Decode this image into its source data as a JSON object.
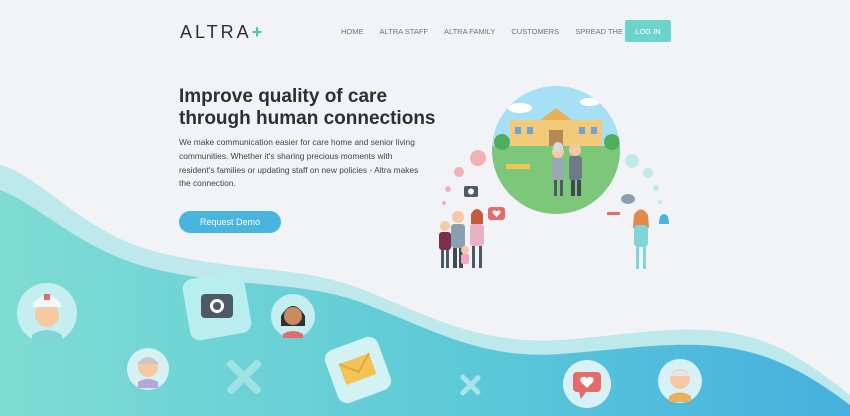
{
  "brand": {
    "name": "ALTRA",
    "mark": "+"
  },
  "nav": {
    "items": [
      "HOME",
      "ALTRA STAFF",
      "ALTRA FAMILY",
      "CUSTOMERS",
      "SPREAD THE WORD"
    ],
    "login_label": "LOG IN"
  },
  "hero": {
    "title_line1": "Improve quality of care",
    "title_line2": "through human connections",
    "body": "We make communication easier for care home and senior living communities. Whether it's sharing precious moments with resident's families or updating staff on new policies - Altra makes the connection.",
    "cta_label": "Request Demo"
  },
  "colors": {
    "background": "#f1f3f7",
    "accent_teal": "#6dd3cd",
    "cta_blue": "#49b5dd",
    "wave_light": "#b7e6ea",
    "wave_main": "#5cc9d3"
  },
  "icons": [
    "nurse-icon",
    "camera-icon",
    "woman-avatar-icon",
    "elderly-woman-icon",
    "cross-icon",
    "letter-icon",
    "chat-heart-icon",
    "elderly-man-icon"
  ]
}
